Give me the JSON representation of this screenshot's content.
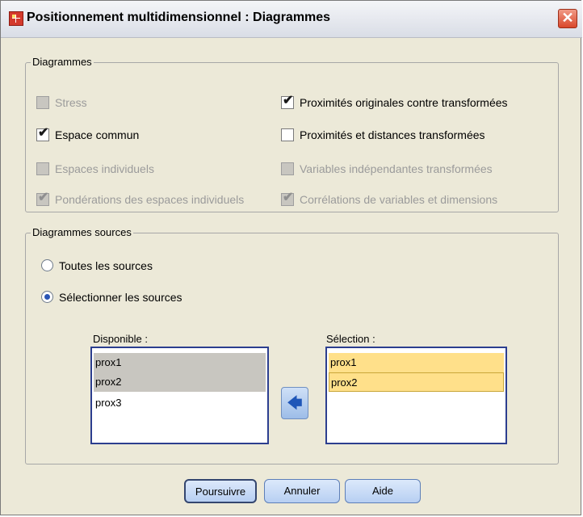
{
  "window": {
    "title": "Positionnement multidimensionnel : Diagrammes",
    "close_glyph": "✕"
  },
  "group_diagrammes": {
    "legend": "Diagrammes",
    "checkboxes": [
      {
        "label": "Stress",
        "checked": false,
        "enabled": false
      },
      {
        "label": "Proximités originales contre transformées",
        "checked": true,
        "enabled": true
      },
      {
        "label": "Espace commun",
        "checked": true,
        "enabled": true
      },
      {
        "label": "Proximités et distances transformées",
        "checked": false,
        "enabled": true
      },
      {
        "label": "Espaces individuels",
        "checked": false,
        "enabled": false
      },
      {
        "label": "Variables indépendantes transformées",
        "checked": false,
        "enabled": false
      },
      {
        "label": "Pondérations des espaces individuels",
        "checked": true,
        "enabled": false
      },
      {
        "label": "Corrélations de variables et dimensions",
        "checked": true,
        "enabled": false
      }
    ]
  },
  "group_sources": {
    "legend": "Diagrammes sources",
    "radios": [
      {
        "label": "Toutes les sources",
        "selected": false
      },
      {
        "label": "Sélectionner les sources",
        "selected": true
      }
    ],
    "available_label": "Disponible :",
    "available_items": [
      "prox1",
      "prox2",
      "prox3"
    ],
    "selection_label": "Sélection :",
    "selection_items": [
      "prox1",
      "prox2"
    ],
    "move_icon": "left-arrow-icon",
    "move_glyph": "🡄"
  },
  "buttons": {
    "continue": "Poursuivre",
    "cancel": "Annuler",
    "help": "Aide"
  },
  "colors": {
    "selected_yellow": "#ffe08a",
    "list_border": "#2c3e8f",
    "button_blue": "#b7cff2"
  }
}
